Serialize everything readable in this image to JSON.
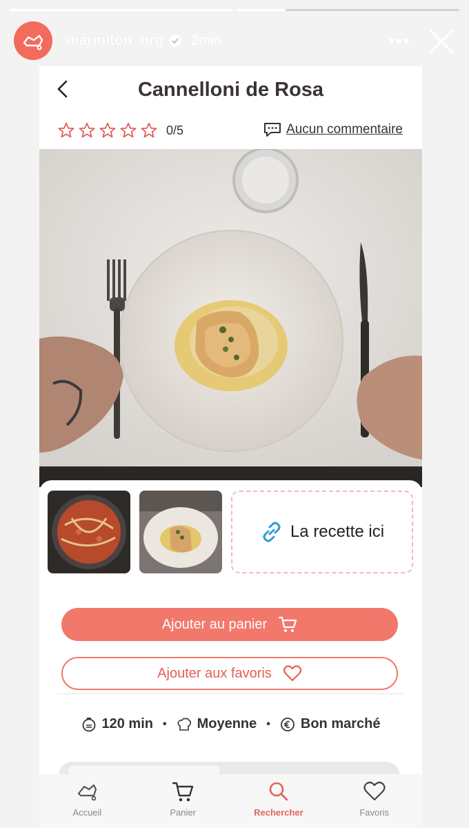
{
  "story": {
    "username": "marmiton_org",
    "time": "2min",
    "segments": [
      {
        "progress": 1.0
      },
      {
        "progress": 0.22
      }
    ],
    "colors": {
      "avatar_bg": "#f26b5b"
    }
  },
  "recipe": {
    "title": "Cannelloni de Rosa",
    "rating": "0/5",
    "stars": 5,
    "comments_label": "Aucun commentaire",
    "link_label": "La recette ici",
    "add_to_cart_label": "Ajouter au panier",
    "add_to_favorites_label": "Ajouter aux favoris",
    "duration": "120 min",
    "difficulty": "Moyenne",
    "cost": "Bon marché",
    "colors": {
      "accent": "#f2786c",
      "link": "#2d9bd6"
    }
  },
  "nav": {
    "items": [
      {
        "label": "Accueil",
        "icon": "home-icon"
      },
      {
        "label": "Panier",
        "icon": "cart-icon"
      },
      {
        "label": "Rechercher",
        "icon": "search-icon"
      },
      {
        "label": "Favoris",
        "icon": "heart-icon"
      }
    ],
    "active": "Rechercher"
  }
}
